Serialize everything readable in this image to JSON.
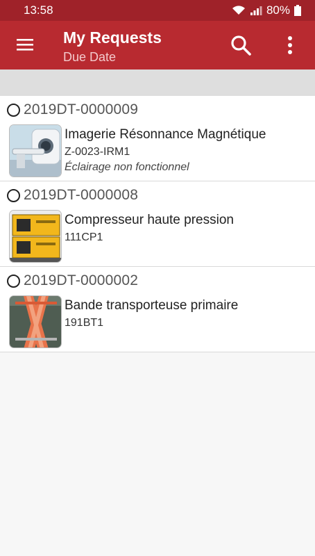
{
  "status_bar": {
    "time": "13:58",
    "battery": "80%"
  },
  "app_bar": {
    "title": "My Requests",
    "subtitle": "Due Date",
    "menu_icon": "hamburger-menu-icon",
    "search_icon": "search-icon",
    "more_icon": "more-vertical-icon"
  },
  "colors": {
    "primary": "#b82a30",
    "status": "#9f2229"
  },
  "requests": [
    {
      "id": "2019DT-0000009",
      "name": "Imagerie Résonnance Magnétique",
      "code": "Z-0023-IRM1",
      "note": "Éclairage non fonctionnel"
    },
    {
      "id": "2019DT-0000008",
      "name": "Compresseur haute pression",
      "code": "111CP1",
      "note": ""
    },
    {
      "id": "2019DT-0000002",
      "name": "Bande transporteuse primaire",
      "code": "191BT1",
      "note": ""
    }
  ]
}
